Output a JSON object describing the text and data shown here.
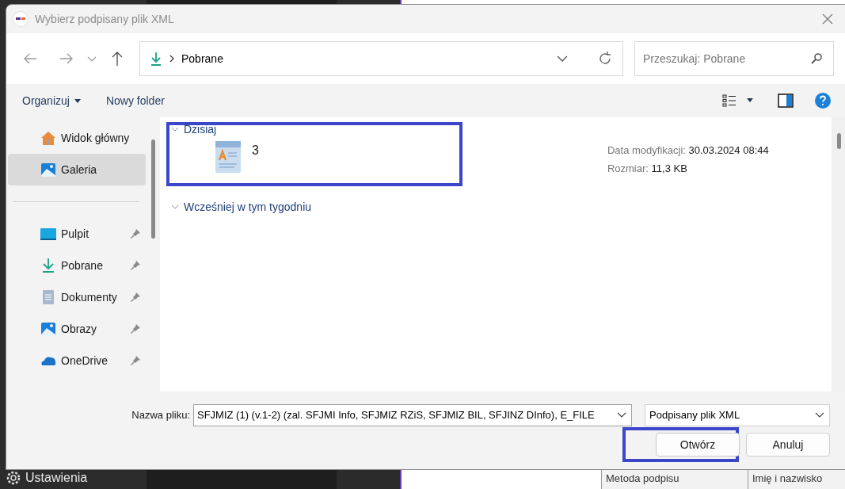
{
  "background_app": {
    "settings_label": "Ustawienia",
    "table_columns": [
      "Metoda podpisu",
      "Imię i nazwisko"
    ]
  },
  "dialog": {
    "title": "Wybierz podpisany plik XML",
    "address": {
      "path": "Pobrane"
    },
    "search": {
      "placeholder": "Przeszukaj: Pobrane"
    },
    "commands": [
      {
        "label": "Organizuj",
        "has_menu": true
      },
      {
        "label": "Nowy folder",
        "has_menu": false
      }
    ],
    "sidebar": {
      "items": [
        {
          "label": "Widok główny",
          "kind": "home",
          "pinned": false,
          "selected": false
        },
        {
          "label": "Galeria",
          "kind": "gallery",
          "pinned": false,
          "selected": true
        },
        {
          "kind": "separator"
        },
        {
          "label": "Pulpit",
          "kind": "desktop",
          "pinned": true,
          "selected": false
        },
        {
          "label": "Pobrane",
          "kind": "download",
          "pinned": true,
          "selected": false
        },
        {
          "label": "Dokumenty",
          "kind": "documents",
          "pinned": true,
          "selected": false
        },
        {
          "label": "Obrazy",
          "kind": "pictures",
          "pinned": true,
          "selected": false
        },
        {
          "label": "OneDrive",
          "kind": "cloud",
          "pinned": true,
          "selected": false
        }
      ]
    },
    "groups": [
      {
        "label": "Dzisiaj",
        "expanded": true,
        "files": [
          {
            "name": "3",
            "highlighted": true,
            "details": [
              {
                "label": "Data modyfikacji:",
                "value": "30.03.2024 08:44"
              },
              {
                "label": "Rozmiar:",
                "value": "11,3 KB"
              }
            ]
          }
        ]
      },
      {
        "label": "Wcześniej w tym tygodniu",
        "expanded": true
      }
    ],
    "footer": {
      "filename_label": "Nazwa pliku:",
      "filename": "SFJMIZ (1) (v.1-2) (zal. SFJMI Info, SFJMIZ RZiS, SFJMIZ BIL, SFJINZ DInfo), E_FILE",
      "file_type": "Podpisany plik XML",
      "buttons": [
        {
          "label": "Otwórz",
          "highlighted": true
        },
        {
          "label": "Anuluj",
          "highlighted": false
        }
      ]
    }
  }
}
